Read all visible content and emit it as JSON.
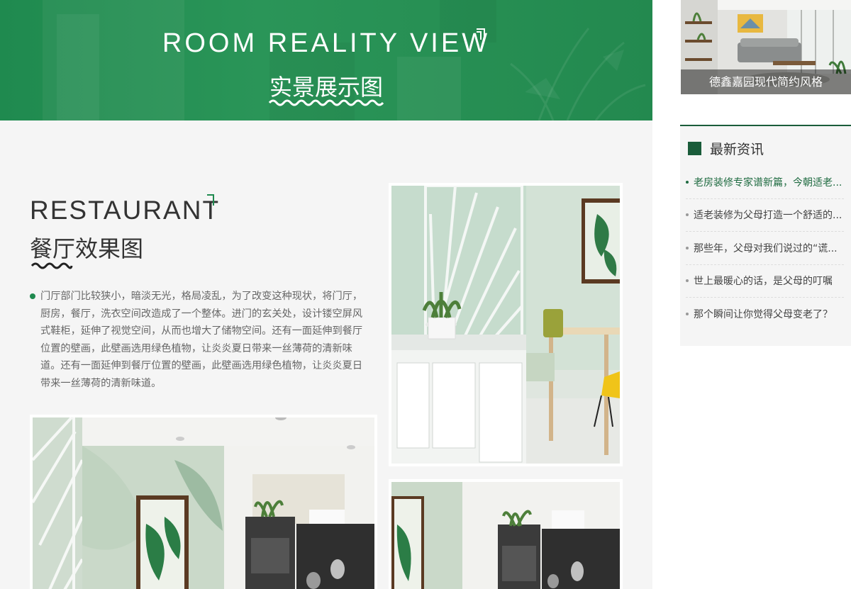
{
  "banner": {
    "title_en": "ROOM REALITY VIEW",
    "title_cn": "实景展示图"
  },
  "section": {
    "title_en": "RESTAURANT",
    "title_cn": "餐厅效果图",
    "description": "门厅部门比较狭小，暗淡无光，格局凌乱，为了改变这种现状，将门厅，厨房，餐厅，洗衣空间改造成了一个整体。进门的玄关处，设计镂空屏风式鞋柜，延伸了视觉空间，从而也增大了储物空间。还有一面延伸到餐厅位置的壁画，此壁画选用绿色植物，让炎炎夏日带来一丝薄荷的清新味道。还有一面延伸到餐厅位置的壁画，此壁画选用绿色植物，让炎炎夏日带来一丝薄荷的清新味道。"
  },
  "sidebar": {
    "case_caption": "德鑫嘉园现代简约风格",
    "news_title": "最新资讯",
    "news": [
      {
        "label": "老房装修专家谱新篇，今朝适老...",
        "active": true
      },
      {
        "label": "适老装修为父母打造一个舒适的...",
        "active": false
      },
      {
        "label": "那些年，父母对我们说过的“谎...",
        "active": false
      },
      {
        "label": "世上最暖心的话，是父母的叮嘱",
        "active": false
      },
      {
        "label": "那个瞬间让你觉得父母变老了？",
        "active": false
      }
    ]
  },
  "colors": {
    "brand_green": "#1f8a4f",
    "dark_green": "#1a5c3a",
    "page_bg": "#f5f5f5"
  }
}
